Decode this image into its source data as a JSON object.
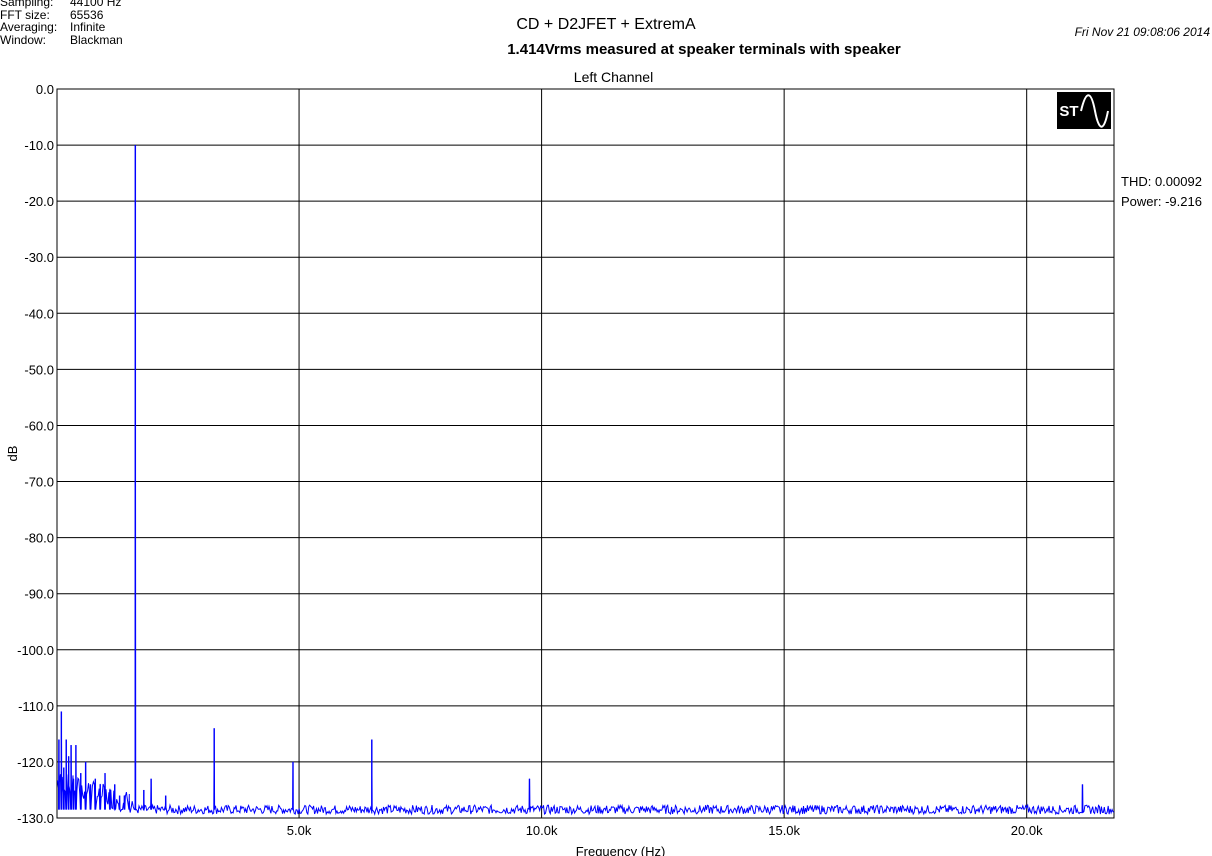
{
  "meta": {
    "sampling_label": "Sampling:",
    "sampling_value": "44100 Hz",
    "fft_label": "FFT size:",
    "fft_value": "65536",
    "averaging_label": "Averaging:",
    "averaging_value": "Infinite",
    "window_label": "Window:",
    "window_value": "Blackman"
  },
  "header": {
    "title": "CD + D2JFET + ExtremA",
    "subtitle": "1.414Vrms measured at speaker terminals with speaker",
    "timestamp": "Fri Nov 21 09:08:06 2014"
  },
  "stats": {
    "thd": "THD: 0.00092",
    "power": "Power: -9.216"
  },
  "logo": {
    "icon": "soundtech-logo-icon",
    "text": "ST"
  },
  "colors": {
    "trace": "#0000ff",
    "grid": "#000000",
    "background": "#ffffff"
  },
  "chart_data": {
    "type": "line",
    "title": "Left Channel",
    "xlabel": "Frequency (Hz)",
    "ylabel": "dB",
    "xlim": [
      10,
      21800
    ],
    "ylim": [
      -130,
      0
    ],
    "x_ticks": [
      5000,
      10000,
      15000,
      20000
    ],
    "x_tick_labels": [
      "5.0k",
      "10.0k",
      "15.0k",
      "20.0k"
    ],
    "y_ticks": [
      0,
      -10,
      -20,
      -30,
      -40,
      -50,
      -60,
      -70,
      -80,
      -90,
      -100,
      -110,
      -120,
      -130
    ],
    "y_tick_labels": [
      "0.0",
      "-10.0",
      "-20.0",
      "-30.0",
      "-40.0",
      "-50.0",
      "-60.0",
      "-70.0",
      "-80.0",
      "-90.0",
      "-100.0",
      "-110.0",
      "-120.0",
      "-130.0"
    ],
    "grid": true,
    "noise_floor_db": -128.5,
    "series": [
      {
        "color": "#0000ff",
        "peaks": [
          {
            "x": 50,
            "y": -116
          },
          {
            "x": 100,
            "y": -111
          },
          {
            "x": 150,
            "y": -121
          },
          {
            "x": 200,
            "y": -116
          },
          {
            "x": 250,
            "y": -119
          },
          {
            "x": 300,
            "y": -117
          },
          {
            "x": 350,
            "y": -123
          },
          {
            "x": 400,
            "y": -117
          },
          {
            "x": 500,
            "y": -122
          },
          {
            "x": 600,
            "y": -120
          },
          {
            "x": 700,
            "y": -124
          },
          {
            "x": 800,
            "y": -123
          },
          {
            "x": 900,
            "y": -124
          },
          {
            "x": 1000,
            "y": -122
          },
          {
            "x": 1100,
            "y": -125
          },
          {
            "x": 1200,
            "y": -124
          },
          {
            "x": 1300,
            "y": -126
          },
          {
            "x": 1400,
            "y": -126
          },
          {
            "x": 1500,
            "y": -127
          },
          {
            "x": 1625,
            "y": -10
          },
          {
            "x": 1800,
            "y": -125
          },
          {
            "x": 1950,
            "y": -123
          },
          {
            "x": 2250,
            "y": -126
          },
          {
            "x": 3250,
            "y": -114
          },
          {
            "x": 4875,
            "y": -120
          },
          {
            "x": 6500,
            "y": -116
          },
          {
            "x": 9750,
            "y": -123
          },
          {
            "x": 21150,
            "y": -124
          }
        ]
      }
    ]
  }
}
